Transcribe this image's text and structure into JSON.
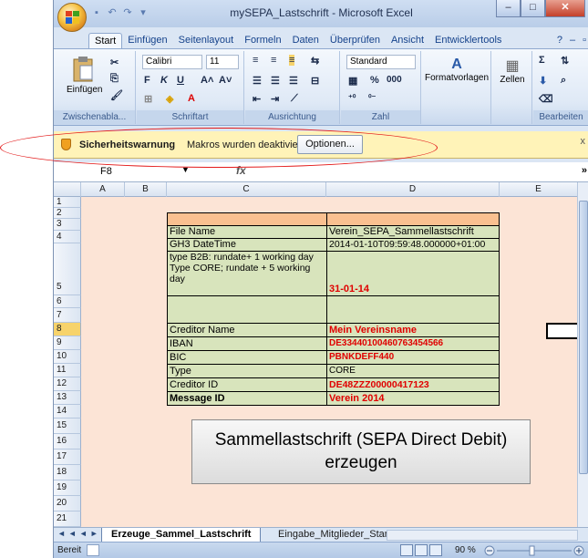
{
  "window": {
    "title": "mySEPA_Lastschrift - Microsoft Excel"
  },
  "ribbon_tabs": [
    "Start",
    "Einfügen",
    "Seitenlayout",
    "Formeln",
    "Daten",
    "Überprüfen",
    "Ansicht",
    "Entwicklertools"
  ],
  "ribbon": {
    "clipboard": {
      "paste_label": "Einfügen",
      "group_label": "Zwischenabla..."
    },
    "font": {
      "name": "Calibri",
      "size": "11",
      "bold": "F",
      "italic": "K",
      "underline": "U",
      "group_label": "Schriftart"
    },
    "alignment": {
      "group_label": "Ausrichtung"
    },
    "number": {
      "format": "Standard",
      "percent": "%",
      "thousands": "000",
      "group_label": "Zahl"
    },
    "styles": {
      "label": "Formatvorlagen"
    },
    "cells": {
      "label": "Zellen"
    },
    "editing": {
      "group_label": "Bearbeiten"
    }
  },
  "security_bar": {
    "title": "Sicherheitswarnung",
    "message": "Makros wurden deaktiviert.",
    "options_button": "Optionen..."
  },
  "formula_bar": {
    "name_box": "F8",
    "fx": "fx",
    "content": ""
  },
  "columns": [
    "A",
    "B",
    "C",
    "D",
    "E"
  ],
  "rows": [
    "1",
    "2",
    "3",
    "4",
    "5",
    "6",
    "7",
    "8",
    "9",
    "10",
    "11",
    "12",
    "13",
    "14",
    "15",
    "16",
    "17",
    "18",
    "19",
    "20",
    "21"
  ],
  "table": {
    "rows": [
      {
        "label": "File Name",
        "value": "Verein_SEPA_Sammellastschrift"
      },
      {
        "label": "GH3 DateTime",
        "value": "2014-01-10T09:59:48.000000+01:00"
      },
      {
        "label": "type B2B: rundate+ 1 working day Type CORE; rundate + 5 working day",
        "value": "31-01-14"
      },
      {
        "label": "Creditor Name",
        "value": "Mein Vereinsname"
      },
      {
        "label": "IBAN",
        "value": "DE33440100460763454566"
      },
      {
        "label": "BIC",
        "value": "PBNKDEFF440"
      },
      {
        "label": "Type",
        "value": "CORE"
      },
      {
        "label": "Creditor ID",
        "value": "DE48ZZZ00000417123"
      },
      {
        "label": "Message ID",
        "value": "Verein 2014"
      }
    ]
  },
  "action_button": {
    "line1": "Sammellastschrift (SEPA Direct Debit)",
    "line2": "erzeugen"
  },
  "sheet_tabs": [
    "Erzeuge_Sammel_Lastschrift",
    "Eingabe_Mitglieder_Stamm"
  ],
  "status": {
    "ready": "Bereit",
    "zoom": "90 %"
  },
  "colors": {
    "sheet_bg": "#fce4d6",
    "table_green": "#d8e4bc",
    "table_header": "#fac090",
    "value_red": "#e00000",
    "security_bar": "#fff3b8"
  }
}
